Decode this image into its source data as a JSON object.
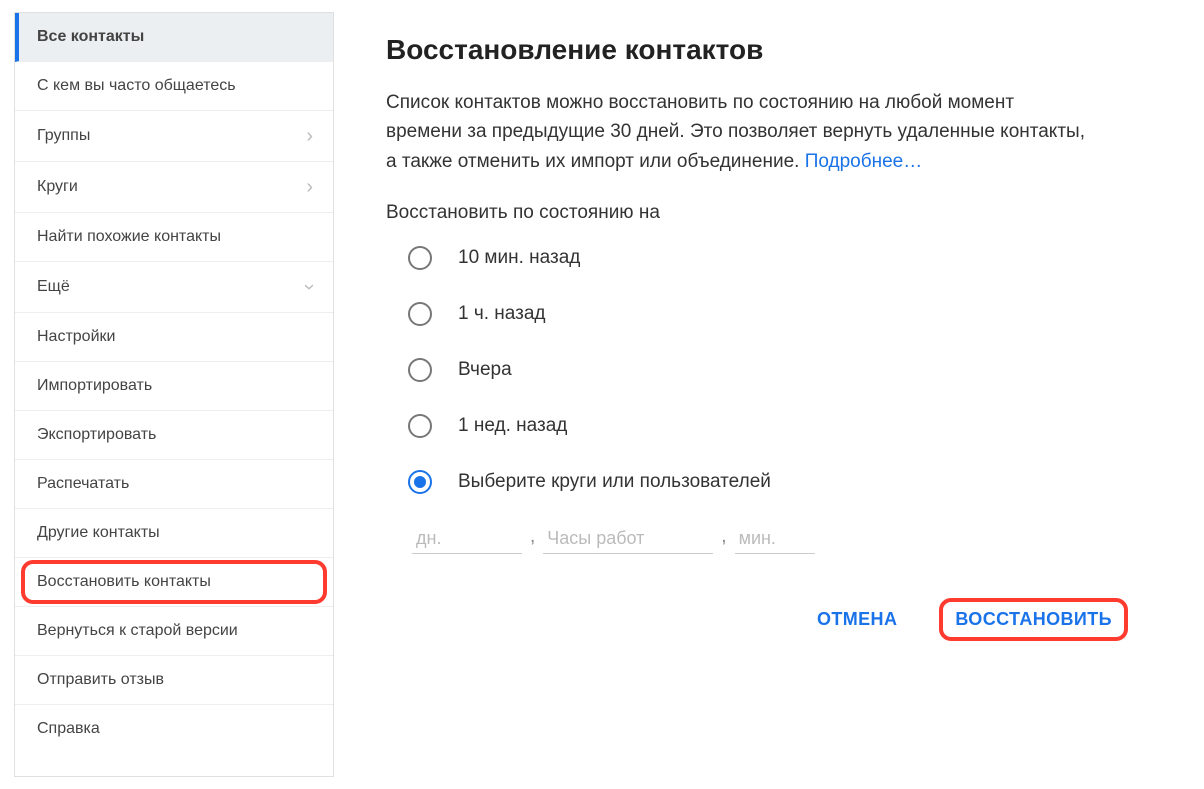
{
  "sidebar": {
    "items": [
      {
        "label": "Все контакты",
        "active": true
      },
      {
        "label": "С кем вы часто общаетесь"
      },
      {
        "label": "Группы",
        "chevron": "right"
      },
      {
        "label": "Круги",
        "chevron": "right"
      },
      {
        "label": "Найти похожие контакты"
      },
      {
        "label": "Ещё",
        "chevron": "down"
      },
      {
        "label": "Настройки"
      },
      {
        "label": "Импортировать"
      },
      {
        "label": "Экспортировать"
      },
      {
        "label": "Распечатать"
      },
      {
        "label": "Другие контакты"
      },
      {
        "label": "Восстановить контакты",
        "highlighted": true
      },
      {
        "label": "Вернуться к старой версии"
      },
      {
        "label": "Отправить отзыв"
      },
      {
        "label": "Справка"
      }
    ]
  },
  "main": {
    "title": "Восстановление контактов",
    "description_1": "Список контактов можно восстановить по состоянию на любой момент времени за предыдущие 30 дней. Это позволяет вернуть удаленные контакты, а также отменить их импорт или объединение. ",
    "more_link": "Подробнее…",
    "subtitle": "Восстановить по состоянию на",
    "radios": [
      {
        "label": "10 мин. назад",
        "selected": false
      },
      {
        "label": "1 ч. назад",
        "selected": false
      },
      {
        "label": "Вчера",
        "selected": false
      },
      {
        "label": "1 нед. назад",
        "selected": false
      },
      {
        "label": "Выберите круги или пользователей",
        "selected": true
      }
    ],
    "inputs": {
      "days_placeholder": "дн.",
      "hours_placeholder": "Часы работ",
      "mins_placeholder": "мин."
    },
    "cancel_label": "ОТМЕНА",
    "restore_label": "ВОССТАНОВИТЬ"
  }
}
